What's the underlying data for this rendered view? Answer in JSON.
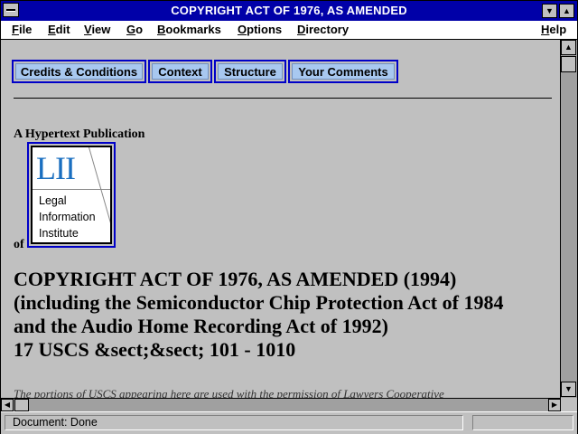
{
  "window": {
    "title": "COPYRIGHT ACT OF 1976, AS AMENDED"
  },
  "menubar": {
    "items": [
      "File",
      "Edit",
      "View",
      "Go",
      "Bookmarks",
      "Options",
      "Directory"
    ],
    "help": "Help"
  },
  "nav": {
    "buttons": [
      "Credits & Conditions",
      "Context",
      "Structure",
      "Your Comments"
    ]
  },
  "doc": {
    "pub_line": "A Hypertext Publication",
    "of_line": "of",
    "logo": {
      "mark": "LII",
      "line1": "Legal",
      "line2": "Information",
      "line3": "Institute"
    },
    "heading": {
      "line1": "COPYRIGHT ACT OF 1976, AS AMENDED (1994)",
      "line2": "(including the Semiconductor Chip Protection Act of 1984",
      "line3": "and the Audio Home Recording Act of 1992)",
      "line4": "17 USCS &sect;&sect; 101 - 1010"
    },
    "permission_text": "The portions of USCS appearing here are used with the permission of Lawyers Cooperative"
  },
  "status": {
    "text": "Document: Done"
  },
  "colors": {
    "titlebar": "#0000a8",
    "link_border": "#0000c8",
    "button_fill": "#a8c8f0",
    "logo_text": "#1a6fc0"
  }
}
